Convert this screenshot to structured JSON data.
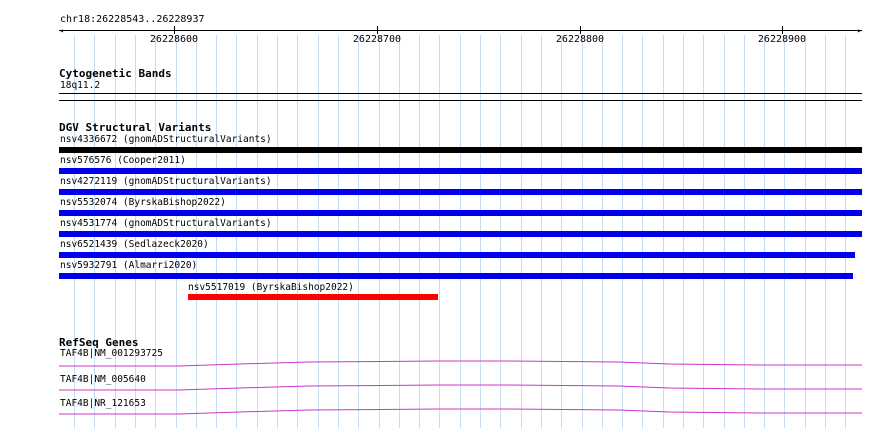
{
  "location": "chr18:26228543..26228937",
  "ruler": {
    "ticks": [
      {
        "label": "26228600"
      },
      {
        "label": "26228700"
      },
      {
        "label": "26228800"
      },
      {
        "label": "26228900"
      }
    ]
  },
  "tracks": {
    "cytoband": {
      "title": "Cytogenetic Bands",
      "band": "18q11.2"
    },
    "dgv": {
      "title": "DGV Structural Variants",
      "features": [
        {
          "label": "nsv4336672 (gnomADStructuralVariants)",
          "color": "#000000"
        },
        {
          "label": "nsv576576 (Cooper2011)",
          "color": "#0000ee"
        },
        {
          "label": "nsv4272119 (gnomADStructuralVariants)",
          "color": "#0000ee"
        },
        {
          "label": "nsv5532074 (ByrskaBishop2022)",
          "color": "#0000ee"
        },
        {
          "label": "nsv4531774 (gnomADStructuralVariants)",
          "color": "#0000ee"
        },
        {
          "label": "nsv6521439 (Sedlazeck2020)",
          "color": "#0000ee"
        },
        {
          "label": "nsv5932791 (Almarri2020)",
          "color": "#0000ee"
        },
        {
          "label": "nsv5517019 (ByrskaBishop2022)",
          "color": "#ff0000"
        }
      ]
    },
    "refseq": {
      "title": "RefSeq Genes",
      "genes": [
        {
          "label": "TAF4B|NM_001293725",
          "color": "#cc33cc"
        },
        {
          "label": "TAF4B|NM_005640",
          "color": "#cc33cc"
        },
        {
          "label": "TAF4B|NR_121653",
          "color": "#cc33cc"
        }
      ]
    }
  }
}
